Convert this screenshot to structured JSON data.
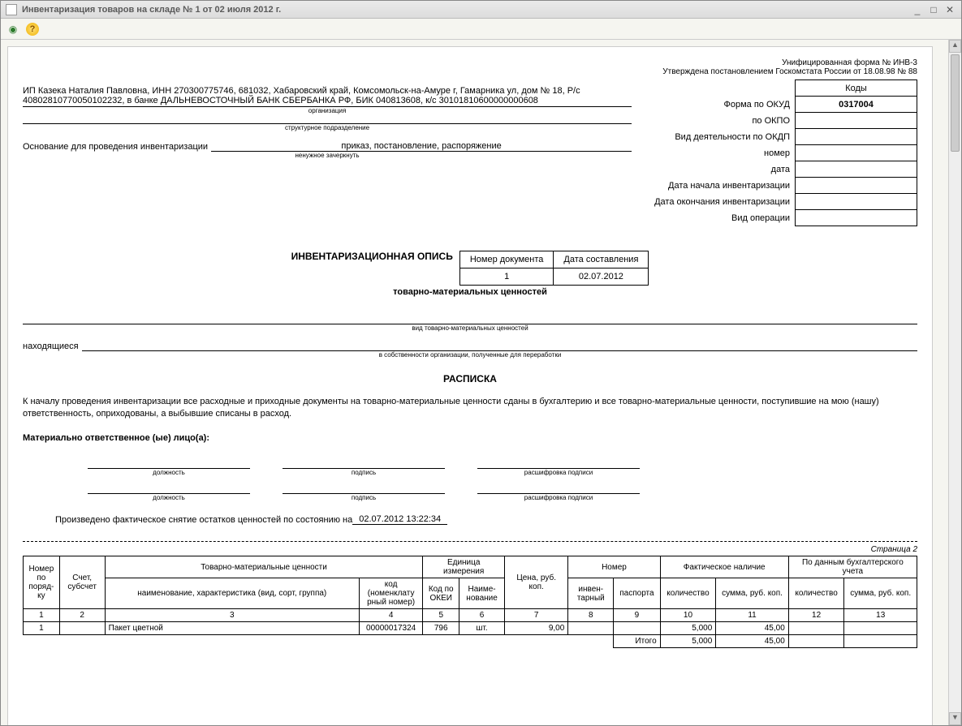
{
  "window": {
    "title": "Инвентаризация товаров на складе № 1 от 02 июля 2012 г."
  },
  "form_meta": {
    "line1": "Унифицированная форма № ИНВ-3",
    "line2": "Утверждена постановлением Госкомстата России от 18.08.98 № 88"
  },
  "codes": {
    "header": "Коды",
    "okud_label": "Форма по ОКУД",
    "okud_value": "0317004",
    "okpo_label": "по ОКПО",
    "okpo_value": "",
    "okdp_label": "Вид деятельности по ОКДП",
    "okdp_value": "",
    "number_label": "номер",
    "number_value": "",
    "date_label": "дата",
    "date_value": "",
    "start_label": "Дата начала инвентаризации",
    "start_value": "",
    "end_label": "Дата окончания инвентаризации",
    "end_value": "",
    "oper_label": "Вид операции",
    "oper_value": ""
  },
  "org": {
    "text": "ИП Казека Наталия Павловна, ИНН 270300775746, 681032, Хабаровский край, Комсомольск-на-Амуре г, Гамарника ул, дом № 18, Р/с 40802810770050102232, в банке ДАЛЬНЕВОСТОЧНЫЙ БАНК СБЕРБАНКА РФ, БИК 040813608, к/с 30101810600000000608",
    "cap1": "организация",
    "cap2": "структурное подразделение"
  },
  "reason": {
    "label": "Основание для проведения инвентаризации",
    "value": "приказ, постановление, распоряжение",
    "cap": "ненужное зачеркнуть"
  },
  "doc": {
    "title": "ИНВЕНТАРИЗАЦИОННАЯ ОПИСЬ",
    "subtitle": "товарно-материальных ценностей",
    "num_hdr": "Номер документа",
    "date_hdr": "Дата составления",
    "num": "1",
    "date": "02.07.2012"
  },
  "caps": {
    "tmc_type": "вид товарно-материальных ценностей",
    "located_label": "находящиеся",
    "ownership": "в собственности организации, полученные для переработки"
  },
  "raspiska": {
    "title": "РАСПИСКА",
    "text": "К началу проведения инвентаризации все расходные и приходные документы на товарно-материальные ценности сданы в бухгалтерию и все товарно-материальные ценности, поступившие на мою (нашу) ответственность, оприходованы, а выбывшие списаны в расход.",
    "resp_label": "Материально ответственное (ые) лицо(а):",
    "sign_position": "должность",
    "sign_sig": "подпись",
    "sign_decode": "расшифровка подписи",
    "taken_label": "Произведено фактическое снятие остатков ценностей по состоянию на",
    "taken_value": "02.07.2012 13:22:34"
  },
  "page2": "Страница 2",
  "table": {
    "headers": {
      "num": "Номер по поряд-ку",
      "account": "Счет, субсчет",
      "tmc": "Товарно-материальные ценности",
      "name": "наименование, характеристика (вид, сорт, группа)",
      "code": "код (номенклату рный номер)",
      "unit": "Единица измерения",
      "okei": "Код по ОКЕИ",
      "unit_name": "Наиме-нование",
      "price": "Цена, руб. коп.",
      "number": "Номер",
      "inv": "инвен-тарный",
      "passport": "паспорта",
      "fact": "Фактическое наличие",
      "book": "По данным бухгалтерского учета",
      "qty": "количество",
      "sum": "сумма, руб. коп."
    },
    "colnums": [
      "1",
      "2",
      "3",
      "4",
      "5",
      "6",
      "7",
      "8",
      "9",
      "10",
      "11",
      "12",
      "13"
    ],
    "rows": [
      {
        "n": "1",
        "acct": "",
        "name": "Пакет цветной",
        "code": "00000017324",
        "okei": "796",
        "unit": "шт.",
        "price": "9,00",
        "inv": "",
        "pass": "",
        "fqty": "5,000",
        "fsum": "45,00",
        "bqty": "",
        "bsum": ""
      }
    ],
    "total_label": "Итого",
    "total_fqty": "5,000",
    "total_fsum": "45,00"
  }
}
